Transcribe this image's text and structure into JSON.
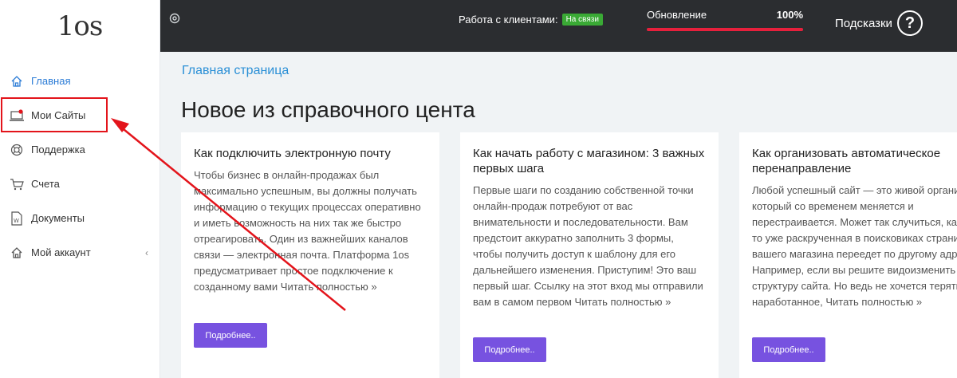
{
  "logo": {
    "text": "1os"
  },
  "sidebar": {
    "items": [
      {
        "label": "Главная",
        "icon": "home-icon"
      },
      {
        "label": "Мои Сайты",
        "icon": "laptop-icon"
      },
      {
        "label": "Поддержка",
        "icon": "lifebuoy-icon"
      },
      {
        "label": "Счета",
        "icon": "cart-icon"
      },
      {
        "label": "Документы",
        "icon": "document-icon"
      },
      {
        "label": "Мой аккаунт",
        "icon": "home-icon",
        "chevron": "‹"
      }
    ]
  },
  "topbar": {
    "work_label": "Работа с клиентами:",
    "work_status": "На связи",
    "update_label": "Обновление",
    "update_percent": "100%",
    "update_progress": 1.0,
    "hints_label": "Подсказки",
    "hints_icon": "?"
  },
  "main": {
    "breadcrumb": "Главная страница",
    "title": "Новое из справочного цента",
    "cards": [
      {
        "title": "Как подключить электронную почту",
        "text": "Чтобы бизнес в онлайн-продажах был максимально успешным, вы должны получать информацию о текущих процессах оперативно и иметь возможность на них так же быстро отреагировать. Один из важнейших каналов связи — электронная почта. Платформа 1os предусматривает простое подключение к созданному вами Читать полностью »",
        "button": "Подробнее.."
      },
      {
        "title": "Как начать работу с магазином: 3 важных первых шага",
        "text": "Первые шаги по созданию собственной точки онлайн-продаж потребуют от вас внимательности и последовательности. Вам предстоит аккуратно заполнить 3 формы, чтобы получить доступ к шаблону для его дальнейшего изменения. Приступим! Это ваш первый шаг. Ссылку на этот вход мы отправили вам в самом первом Читать полностью »",
        "button": "Подробнее.."
      },
      {
        "title": "Как организовать автоматическое перенаправление",
        "text": "Любой успешный сайт — это живой организм, который со временем меняется и перестраивается. Может так случиться, какая-то уже раскрученная в поисковиках страница вашего магазина переедет по другому адресу. Например, если вы решите видоизменить структуру сайта. Но ведь не хочется терять все наработанное, Читать полностью »",
        "button": "Подробнее.."
      }
    ]
  },
  "colors": {
    "accent_blue": "#2a8fd6",
    "button_purple": "#7752e0",
    "topbar_bg": "#2b2d30",
    "status_green": "#3aaa35",
    "progress_red": "#e6203c",
    "annotation_red": "#e3141b"
  }
}
